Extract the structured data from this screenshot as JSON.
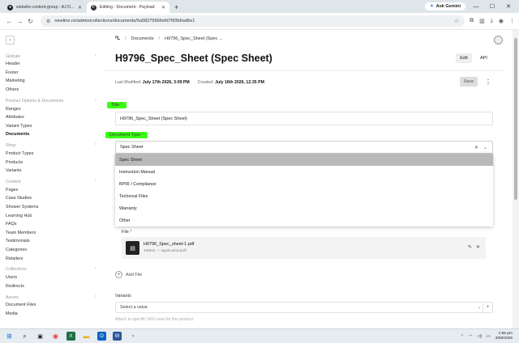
{
  "browser": {
    "tabs": [
      {
        "label": "website-content-group - AJ D...",
        "active": false
      },
      {
        "label": "Editing - Document - Payload",
        "active": true
      }
    ],
    "ask_gemini": "Ask Gemini",
    "url": "newline.nz/admin/collections/documents/6a58275666efd76f3b6ad6e1"
  },
  "sidebar": {
    "groups": [
      {
        "title": "Globals",
        "items": [
          "Header",
          "Footer",
          "Marketing",
          "Others"
        ]
      },
      {
        "title": "Product Options & Documents",
        "items": [
          "Ranges",
          "Attributes",
          "Variant Types",
          "Documents"
        ]
      },
      {
        "title": "Shop",
        "items": [
          "Product Types",
          "Products",
          "Variants"
        ]
      },
      {
        "title": "Content",
        "items": [
          "Pages",
          "Case Studies",
          "Shower Systems",
          "Learning Hub",
          "FAQs",
          "Team Members",
          "Testimonials",
          "Categories",
          "Retailers"
        ]
      },
      {
        "title": "Collections",
        "items": [
          "Users",
          "Redirects"
        ]
      },
      {
        "title": "Assets",
        "items": [
          "Document Files",
          "Media"
        ]
      }
    ],
    "active_item": "Documents"
  },
  "breadcrumb": {
    "root": "Documents",
    "current": "H9796_Spec_Sheet (Spec ..."
  },
  "document": {
    "title": "H9796_Spec_Sheet (Spec Sheet)",
    "edit_label": "Edit",
    "api_label": "API",
    "last_modified_label": "Last Modified:",
    "last_modified": "July 17th 2026, 3:09 PM",
    "created_label": "Created:",
    "created": "July 16th 2026, 12:35 PM",
    "save_label": "Save"
  },
  "fields": {
    "title_label": "Title",
    "title_value": "H9796_Spec_Sheet (Spec Sheet)",
    "doctype_label": "Document Type",
    "doctype_value": "Spec Sheet",
    "doctype_options": [
      "Spec Sheet",
      "Instruction Manual",
      "BPIR / Compliance",
      "Technical Files",
      "Warranty",
      "Other"
    ],
    "file_label": "File",
    "file_name": "H9796_Spec_sheet-1.pdf",
    "file_info": "168KB — application/pdf",
    "add_file_label": "Add File",
    "variants_label": "Variants",
    "variants_placeholder": "Select a value",
    "variants_hint": "Attach to specific SKU rows for this product."
  },
  "taskbar": {
    "time": "1:55 pm",
    "date": "3/08/2026"
  },
  "colors": {
    "highlight": "#39ff14",
    "selected_option": "#b9b9b9"
  }
}
